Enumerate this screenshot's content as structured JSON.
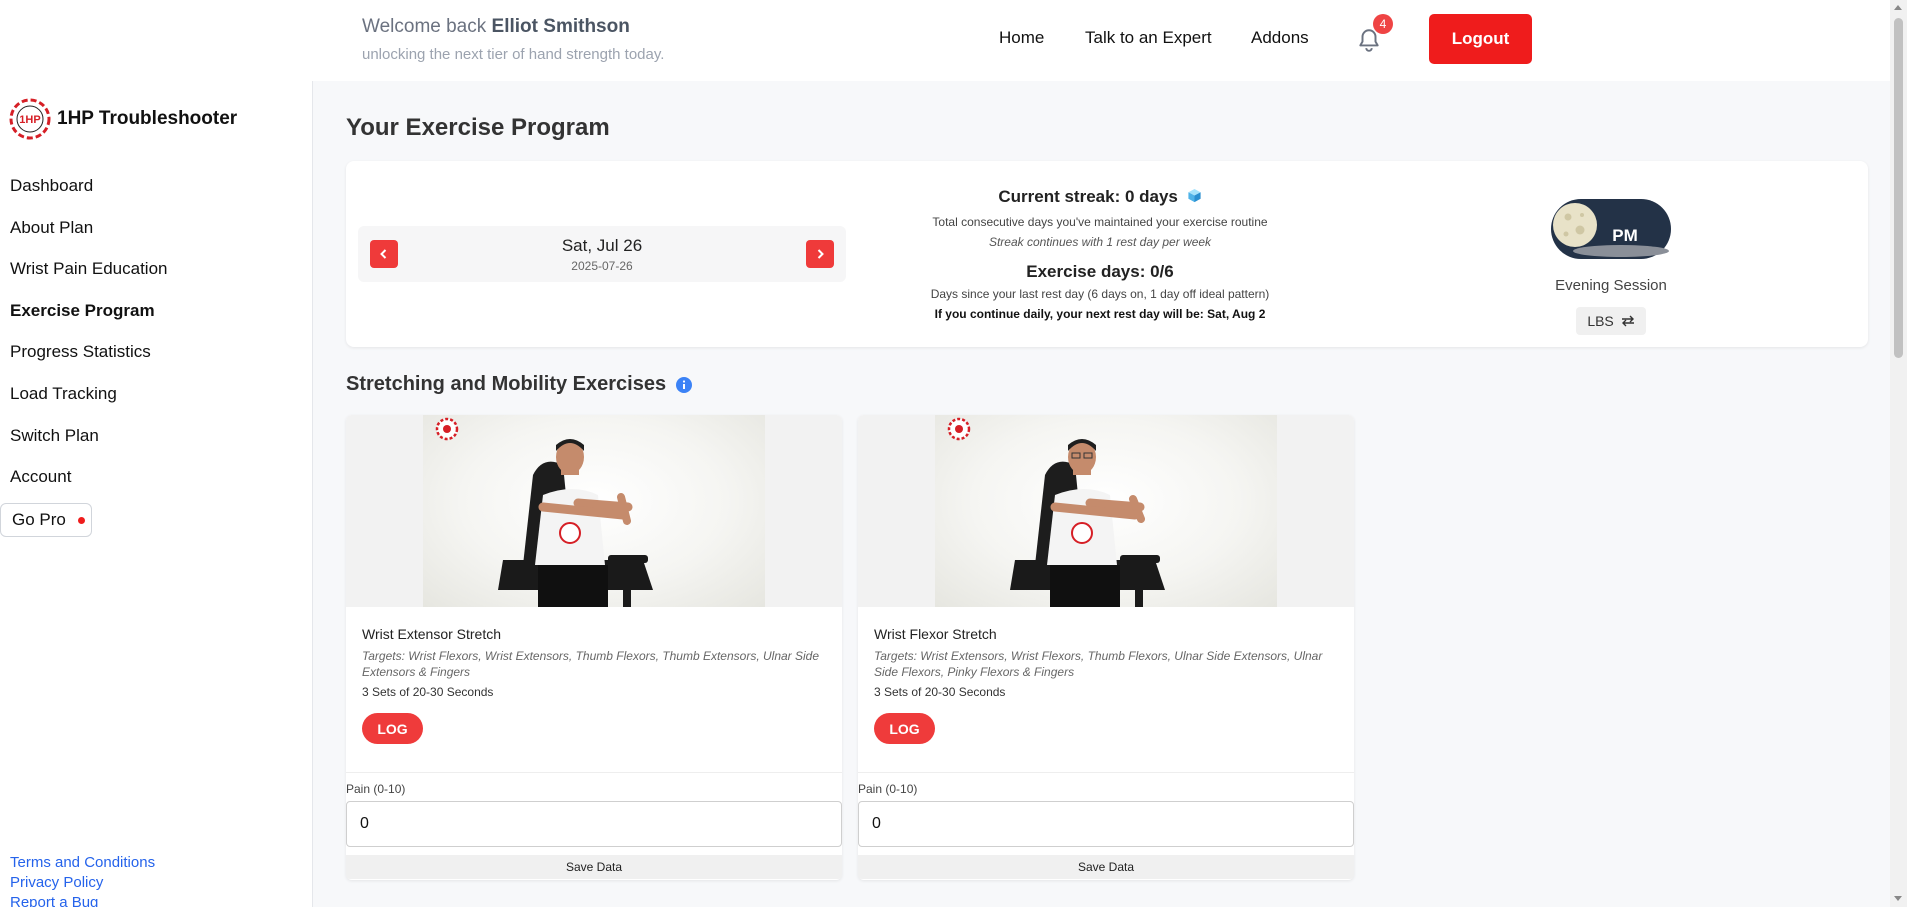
{
  "header": {
    "welcome_prefix": "Welcome back",
    "user_name": "Elliot Smithson",
    "subtitle": "unlocking the next tier of hand strength today.",
    "nav": [
      "Home",
      "Talk to an Expert",
      "Addons"
    ],
    "notification_count": "4",
    "logout_label": "Logout"
  },
  "sidebar": {
    "brand": "1HP Troubleshooter",
    "brand_logo_text": "1HP",
    "items": [
      {
        "label": "Dashboard"
      },
      {
        "label": "About Plan"
      },
      {
        "label": "Wrist Pain Education"
      },
      {
        "label": "Exercise Program",
        "active": true
      },
      {
        "label": "Progress Statistics"
      },
      {
        "label": "Load Tracking"
      },
      {
        "label": "Switch Plan"
      },
      {
        "label": "Account"
      }
    ],
    "gopro_label": "Go Pro",
    "footer_links": [
      "Terms and Conditions",
      "Privacy Policy",
      "Report a Bug"
    ]
  },
  "main": {
    "page_title": "Your Exercise Program",
    "date": {
      "display": "Sat, Jul 26",
      "iso": "2025-07-26"
    },
    "streak": {
      "title": "Current streak: 0 days",
      "desc": "Total consecutive days you've maintained your exercise routine",
      "note": "Streak continues with 1 rest day per week"
    },
    "exercise_days": {
      "title": "Exercise days: 0/6",
      "desc": "Days since your last rest day (6 days on, 1 day off ideal pattern)",
      "rest_prefix": "If you continue daily, your next rest day will be:",
      "rest_date": "Sat, Aug 2"
    },
    "session": {
      "toggle_label": "PM",
      "label": "Evening Session",
      "unit_label": "LBS"
    },
    "section_title": "Stretching and Mobility Exercises",
    "exercises": [
      {
        "name": "Wrist Extensor Stretch",
        "targets": "Targets: Wrist Flexors, Wrist Extensors, Thumb Flexors, Thumb Extensors, Ulnar Side Extensors & Fingers",
        "sets": "3 Sets of 20-30 Seconds",
        "log_label": "LOG",
        "pain_label": "Pain (0-10)",
        "pain_value": "0",
        "save_label": "Save Data"
      },
      {
        "name": "Wrist Flexor Stretch",
        "targets": "Targets: Wrist Extensors, Wrist Flexors, Thumb Flexors, Ulnar Side Extensors, Ulnar Side Flexors, Pinky Flexors & Fingers",
        "sets": "3 Sets of 20-30 Seconds",
        "log_label": "LOG",
        "pain_label": "Pain (0-10)",
        "pain_value": "0",
        "save_label": "Save Data"
      }
    ]
  },
  "colors": {
    "accent": "#ef1c1c",
    "link": "#2563eb",
    "session_toggle": "#233247"
  }
}
